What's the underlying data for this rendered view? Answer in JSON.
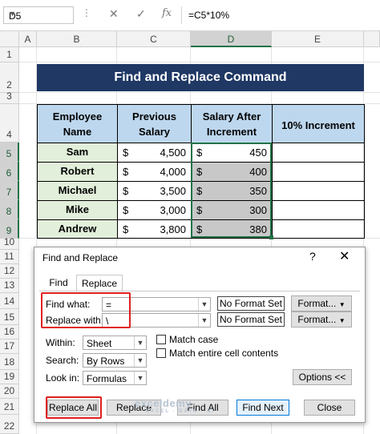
{
  "formula_bar": {
    "name_box": "D5",
    "fx_label": "fx",
    "cancel_glyph": "✕",
    "enter_glyph": "✓",
    "formula": "=C5*10%"
  },
  "columns": [
    "A",
    "B",
    "C",
    "D",
    "E"
  ],
  "rows": [
    "1",
    "2",
    "3",
    "4",
    "5",
    "6",
    "7",
    "8",
    "9",
    "10",
    "11",
    "12",
    "13",
    "14",
    "15",
    "16",
    "17",
    "18",
    "19",
    "20",
    "21",
    "22"
  ],
  "sheet": {
    "title": "Find and Replace Command",
    "headers": {
      "employee": "Employee Name",
      "previous": "Previous Salary",
      "after": "Salary After Increment",
      "increment": "10% Increment"
    },
    "currency": "$",
    "employees": [
      {
        "name": "Sam",
        "previous": "4,500",
        "after": "450"
      },
      {
        "name": "Robert",
        "previous": "4,000",
        "after": "400"
      },
      {
        "name": "Michael",
        "previous": "3,500",
        "after": "350"
      },
      {
        "name": "Mike",
        "previous": "3,000",
        "after": "300"
      },
      {
        "name": "Andrew",
        "previous": "3,800",
        "after": "380"
      }
    ]
  },
  "dialog": {
    "title": "Find and Replace",
    "help": "?",
    "close": "✕",
    "tabs": [
      "Find",
      "Replace"
    ],
    "active_tab": "Replace",
    "find_label": "Find what:",
    "find_value": "=",
    "replace_label": "Replace with:",
    "replace_value": "\\",
    "no_format": "No Format Set",
    "format_button": "Format...",
    "within_label": "Within:",
    "within_value": "Sheet",
    "search_label": "Search:",
    "search_value": "By Rows",
    "lookin_label": "Look in:",
    "lookin_value": "Formulas",
    "match_case": "Match case",
    "match_entire": "Match entire cell contents",
    "options_button": "Options <<",
    "buttons": {
      "replace_all": "Replace All",
      "replace": "Replace",
      "find_all": "Find All",
      "find_next": "Find Next",
      "close": "Close"
    }
  },
  "watermark": {
    "main": "exceldemy",
    "sub": "EXCEL · DATA · BI"
  },
  "colors": {
    "title_bg": "#1f3864",
    "header_bg": "#bdd7ee",
    "name_bg": "#e2efda",
    "highlight": "#e02020",
    "selection": "#217346"
  }
}
